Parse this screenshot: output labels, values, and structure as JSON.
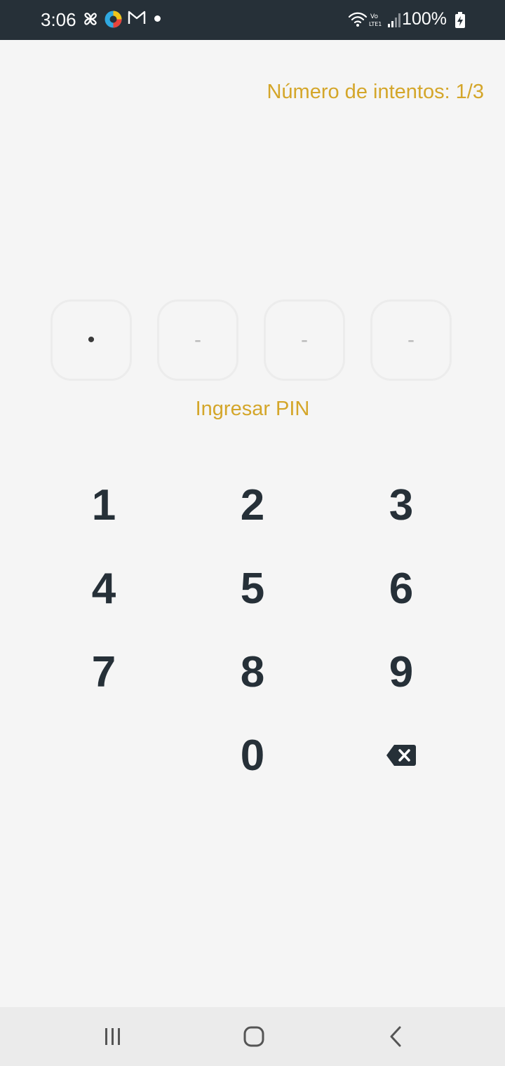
{
  "status_bar": {
    "time": "3:06",
    "battery": "100%",
    "left_icons": [
      "pinwheel-icon",
      "colorful-app-icon",
      "gmail-icon",
      "notification-dot"
    ],
    "right_icons": [
      "wifi-icon",
      "volte-icon",
      "signal-icon",
      "battery-charging-icon"
    ]
  },
  "attempts_label": "Número de intentos: 1/3",
  "pin": {
    "boxes": [
      "•",
      "-",
      "-",
      "-"
    ],
    "filled_count": 1,
    "prompt": "Ingresar PIN"
  },
  "keypad": {
    "keys": [
      "1",
      "2",
      "3",
      "4",
      "5",
      "6",
      "7",
      "8",
      "9",
      "0"
    ],
    "backspace_icon": "backspace-icon"
  },
  "navigation": {
    "recent_icon": "recent-apps-icon",
    "home_icon": "home-icon",
    "back_icon": "back-icon"
  },
  "colors": {
    "status_bar_bg": "#263038",
    "accent": "#d4a62a",
    "key_text": "#263038",
    "background": "#f5f5f5"
  }
}
